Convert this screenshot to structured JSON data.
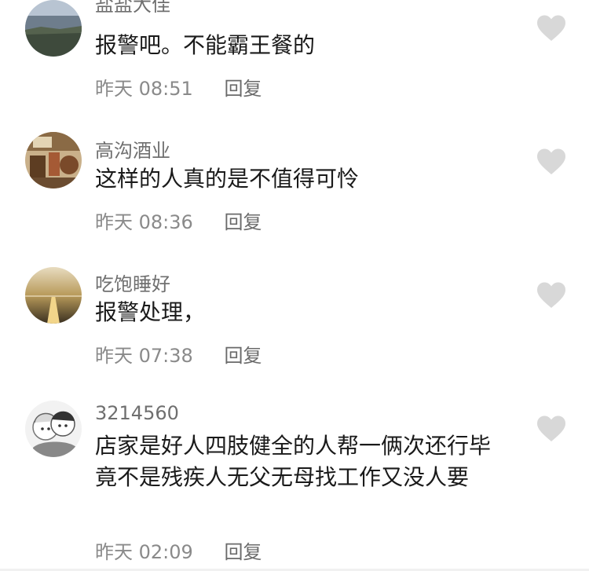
{
  "comments": [
    {
      "name": "盐盐大佳",
      "text": "报警吧。不能霸王餐的",
      "time": "昨天 08:51",
      "reply_label": "回复",
      "avatar_icon": "landscape-avatar-icon"
    },
    {
      "name": "高沟酒业",
      "text": "这样的人真的是不值得可怜",
      "time": "昨天 08:36",
      "reply_label": "回复",
      "avatar_icon": "interior-avatar-icon"
    },
    {
      "name": "吃饱睡好",
      "text": "报警处理，",
      "time": "昨天 07:38",
      "reply_label": "回复",
      "avatar_icon": "sunset-avatar-icon"
    },
    {
      "name": "3214560",
      "text": "店家是好人四肢健全的人帮一俩次还行毕竟不是残疾人无父无母找工作又没人要",
      "time": "昨天 02:09",
      "reply_label": "回复",
      "avatar_icon": "anime-avatar-icon"
    }
  ],
  "colors": {
    "name": "#6f6f6f",
    "text": "#1a1a1a",
    "meta": "#8a8a8a",
    "heart": "#d8d8d8"
  },
  "icons": {
    "like": "heart-icon"
  }
}
